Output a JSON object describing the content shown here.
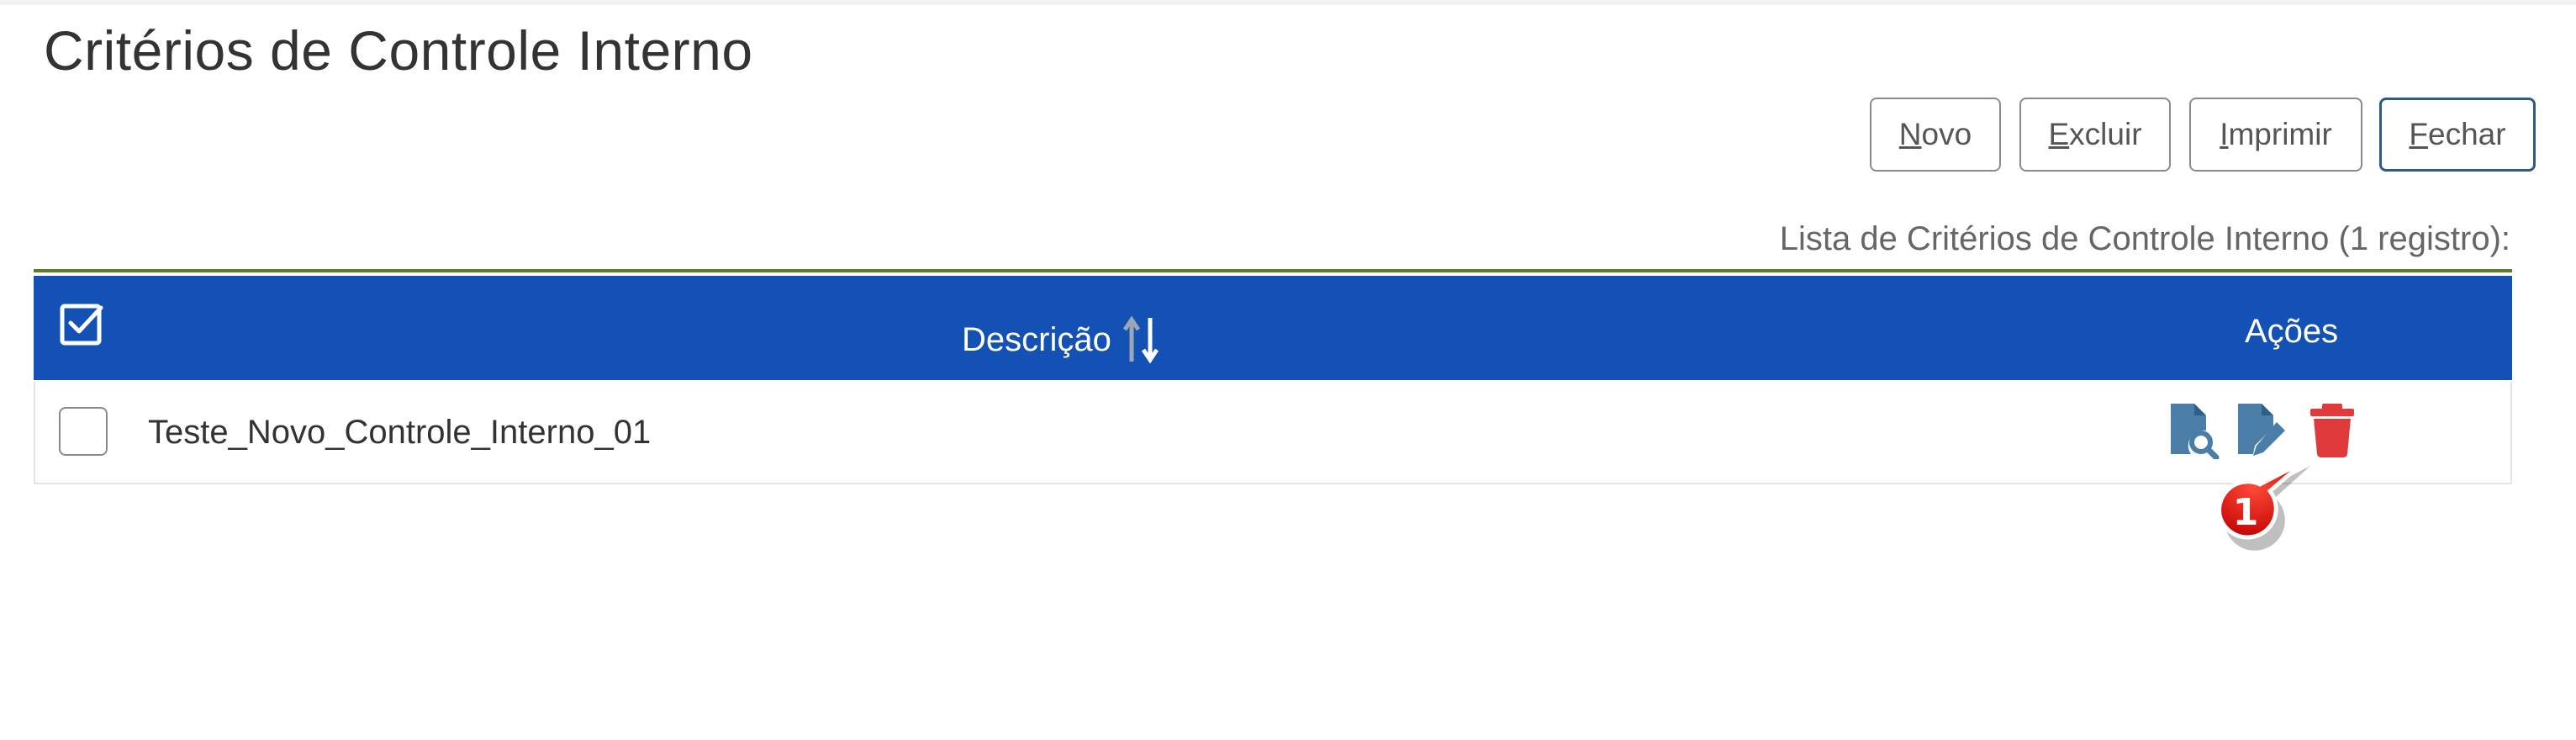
{
  "page": {
    "title": "Critérios de Controle Interno"
  },
  "toolbar": {
    "novo": {
      "access_key": "N",
      "rest": "ovo"
    },
    "excluir": {
      "access_key": "E",
      "rest": "xcluir"
    },
    "imprimir": {
      "access_key": "I",
      "rest": "mprimir"
    },
    "fechar": {
      "access_key": "F",
      "rest": "echar"
    }
  },
  "list": {
    "caption": "Lista de Critérios de Controle Interno (1 registro):",
    "columns": {
      "descricao": "Descrição",
      "acoes": "Ações"
    },
    "rows": [
      {
        "descricao": "Teste_Novo_Controle_Interno_01",
        "actions": [
          "view-document-icon",
          "edit-document-icon",
          "trash-icon"
        ]
      }
    ]
  },
  "annotation": {
    "callout_number": "1"
  },
  "colors": {
    "header_bg": "#1351b4",
    "action_icon": "#4a7ea8",
    "delete_icon": "#e03b3b",
    "callout": "#d41414",
    "header_rule": "#5b7d2a"
  }
}
